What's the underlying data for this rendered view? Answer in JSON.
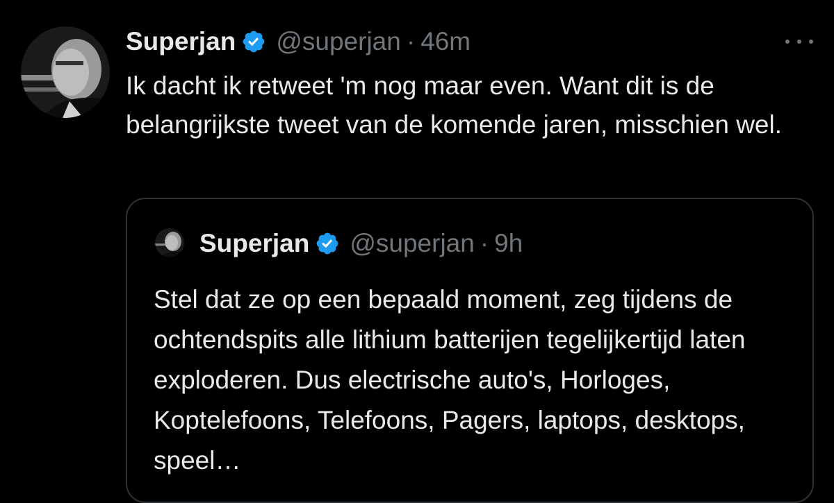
{
  "tweet": {
    "author_name": "Superjan",
    "handle": "@superjan",
    "separator": "·",
    "time": "46m",
    "text": "Ik dacht ik retweet 'm nog maar even. Want dit is de belangrijkste tweet van de komende jaren, misschien wel.",
    "verified": true,
    "avatar": "profile-photo",
    "more_icon": "more-horizontal-icon"
  },
  "quoted_tweet": {
    "author_name": "Superjan",
    "handle": "@superjan",
    "separator": "·",
    "time": "9h",
    "text": "Stel dat ze op een bepaald moment, zeg tijdens de ochtendspits alle lithium batterijen tegelijkertijd laten exploderen. Dus electrische auto's, Horloges, Koptelefoons, Telefoons, Pagers, laptops, desktops, speel…",
    "verified": true,
    "avatar": "profile-photo"
  },
  "colors": {
    "background": "#000000",
    "text_primary": "#e7e9ea",
    "text_secondary": "#71767b",
    "verified_blue": "#1d9bf0",
    "border": "#2f3336"
  }
}
